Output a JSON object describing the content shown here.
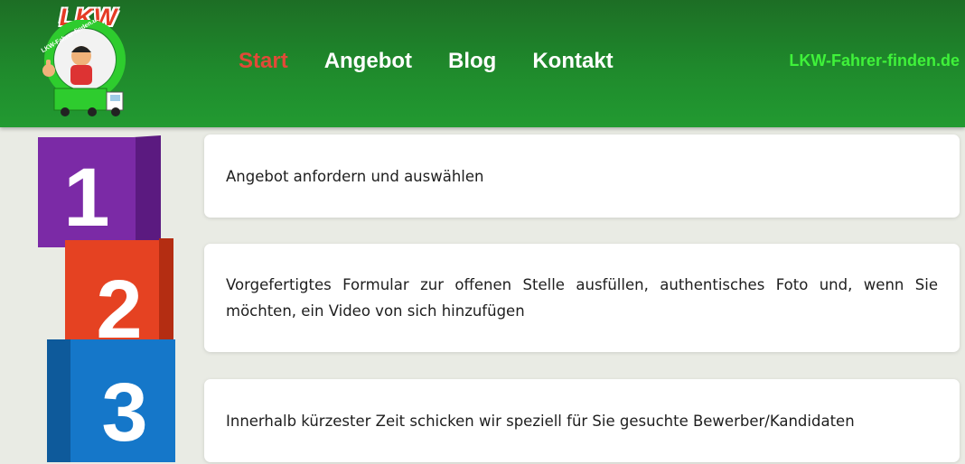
{
  "header": {
    "logo": {
      "text": "LKW",
      "ring_text": "LKW-Fahrer-finden.de"
    },
    "nav": [
      {
        "label": "Start",
        "active": true
      },
      {
        "label": "Angebot",
        "active": false
      },
      {
        "label": "Blog",
        "active": false
      },
      {
        "label": "Kontakt",
        "active": false
      }
    ],
    "site_name": "LKW-Fahrer-finden.de"
  },
  "steps": [
    {
      "number": "1",
      "color": "#7b2aa6",
      "text": "Angebot anfordern und auswählen"
    },
    {
      "number": "2",
      "color": "#e54222",
      "text": "Vorgefertigtes Formular zur offenen Stelle ausfüllen, authentisches Foto und, wenn Sie möchten, ein Video von sich hinzufügen"
    },
    {
      "number": "3",
      "color": "#1577c9",
      "text": "Innerhalb kürzester Zeit schicken wir speziell für Sie gesuchte Bewerber/Kandidaten"
    }
  ],
  "colors": {
    "header_green": "#1f8a2c",
    "nav_active": "#e14a38",
    "site_name": "#3ff23a",
    "background": "#e9ebe4"
  }
}
